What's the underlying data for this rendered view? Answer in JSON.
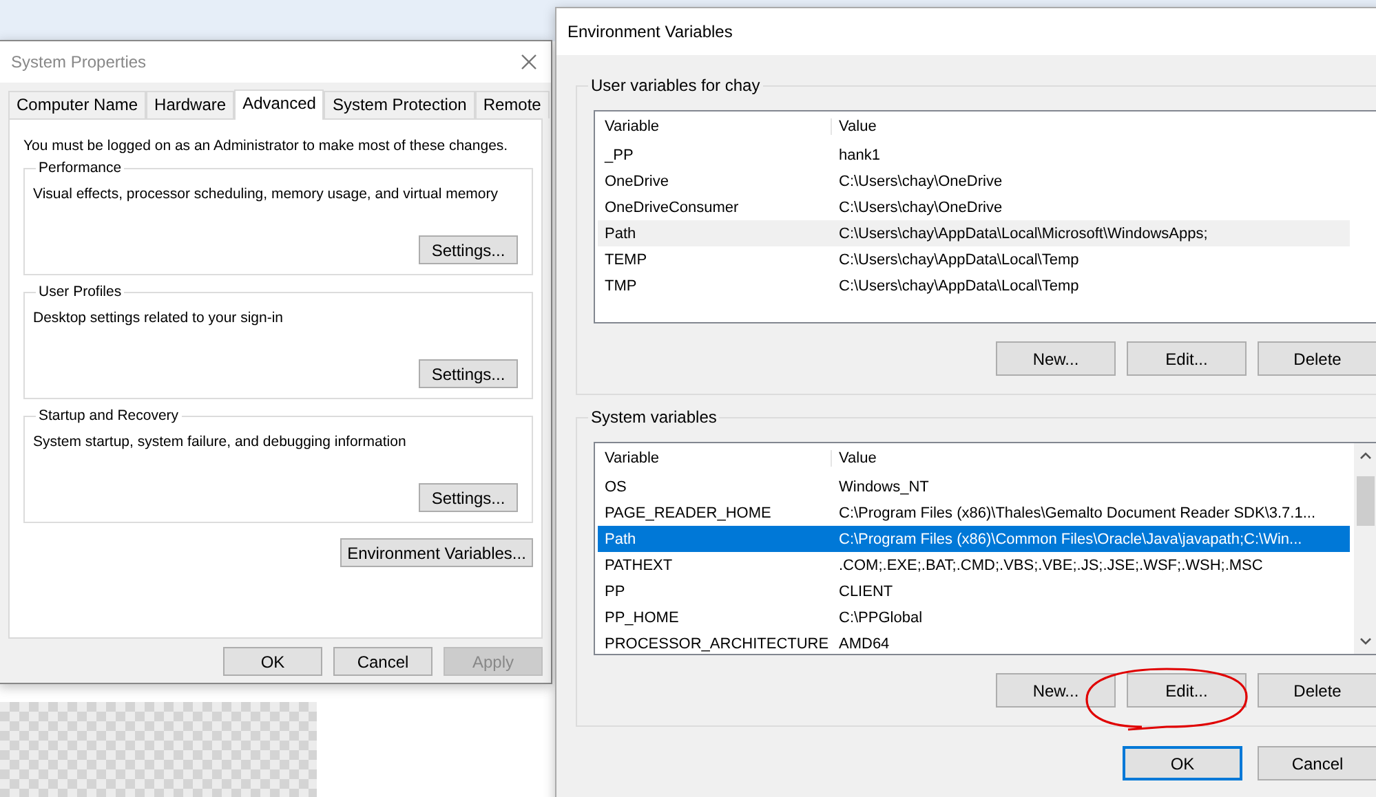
{
  "system_properties": {
    "title": "System Properties",
    "tabs": [
      {
        "label": "Computer Name",
        "selected": false
      },
      {
        "label": "Hardware",
        "selected": false
      },
      {
        "label": "Advanced",
        "selected": true
      },
      {
        "label": "System Protection",
        "selected": false
      },
      {
        "label": "Remote",
        "selected": false
      }
    ],
    "notice": "You must be logged on as an Administrator to make most of these changes.",
    "groups": [
      {
        "title": "Performance",
        "description": "Visual effects, processor scheduling, memory usage, and virtual memory",
        "button": "Settings..."
      },
      {
        "title": "User Profiles",
        "description": "Desktop settings related to your sign-in",
        "button": "Settings..."
      },
      {
        "title": "Startup and Recovery",
        "description": "System startup, system failure, and debugging information",
        "button": "Settings..."
      }
    ],
    "env_button": "Environment Variables...",
    "buttons": [
      {
        "label": "OK",
        "disabled": false
      },
      {
        "label": "Cancel",
        "disabled": false
      },
      {
        "label": "Apply",
        "disabled": true
      }
    ]
  },
  "environment_variables": {
    "title": "Environment Variables",
    "lists": [
      {
        "title": "User variables for chay",
        "focused": false,
        "scrollbar": false,
        "columns": [
          "Variable",
          "Value"
        ],
        "rows": [
          {
            "variable": "_PP",
            "value": "hank1",
            "selected": false
          },
          {
            "variable": "OneDrive",
            "value": "C:\\Users\\chay\\OneDrive",
            "selected": false
          },
          {
            "variable": "OneDriveConsumer",
            "value": "C:\\Users\\chay\\OneDrive",
            "selected": false
          },
          {
            "variable": "Path",
            "value": "C:\\Users\\chay\\AppData\\Local\\Microsoft\\WindowsApps;",
            "selected": true
          },
          {
            "variable": "TEMP",
            "value": "C:\\Users\\chay\\AppData\\Local\\Temp",
            "selected": false
          },
          {
            "variable": "TMP",
            "value": "C:\\Users\\chay\\AppData\\Local\\Temp",
            "selected": false
          }
        ],
        "buttons": [
          "New...",
          "Edit...",
          "Delete"
        ]
      },
      {
        "title": "System variables",
        "focused": true,
        "scrollbar": true,
        "columns": [
          "Variable",
          "Value"
        ],
        "rows": [
          {
            "variable": "OS",
            "value": "Windows_NT",
            "selected": false
          },
          {
            "variable": "PAGE_READER_HOME",
            "value": "C:\\Program Files (x86)\\Thales\\Gemalto Document Reader SDK\\3.7.1...",
            "selected": false
          },
          {
            "variable": "Path",
            "value": "C:\\Program Files (x86)\\Common Files\\Oracle\\Java\\javapath;C:\\Win...",
            "selected": true
          },
          {
            "variable": "PATHEXT",
            "value": ".COM;.EXE;.BAT;.CMD;.VBS;.VBE;.JS;.JSE;.WSF;.WSH;.MSC",
            "selected": false
          },
          {
            "variable": "PP",
            "value": "CLIENT",
            "selected": false
          },
          {
            "variable": "PP_HOME",
            "value": "C:\\PPGlobal",
            "selected": false
          },
          {
            "variable": "PROCESSOR_ARCHITECTURE",
            "value": "AMD64",
            "selected": false
          }
        ],
        "buttons": [
          "New...",
          "Edit...",
          "Delete"
        ]
      }
    ],
    "buttons": [
      {
        "label": "OK",
        "default": true
      },
      {
        "label": "Cancel",
        "default": false
      }
    ]
  }
}
